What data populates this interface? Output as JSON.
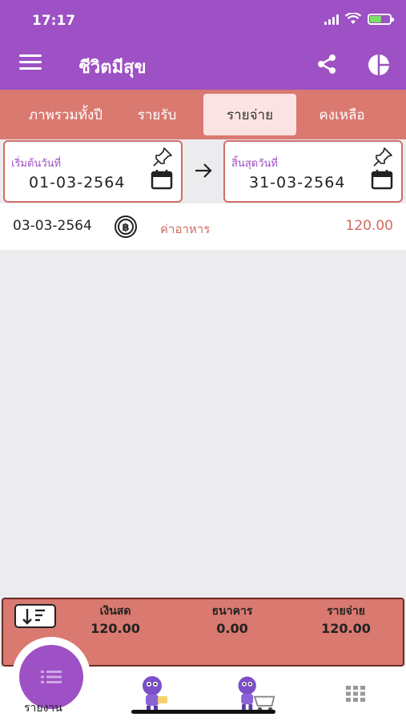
{
  "status": {
    "time": "17:17"
  },
  "header": {
    "title": "ชีวิตมีสุข"
  },
  "tabs": [
    {
      "label": "ภาพรวมทั้งปี",
      "active": false
    },
    {
      "label": "รายรับ",
      "active": false
    },
    {
      "label": "รายจ่าย",
      "active": true
    },
    {
      "label": "คงเหลือ",
      "active": false
    }
  ],
  "date_range": {
    "start": {
      "label": "เริ่มต้นวันที่",
      "value": "01-03-2564"
    },
    "end": {
      "label": "สิ้นสุดวันที่",
      "value": "31-03-2564"
    }
  },
  "transactions": [
    {
      "date": "03-03-2564",
      "icon": "baht-coin-icon",
      "category": "ค่าอาหาร",
      "amount": "120.00"
    }
  ],
  "summary": {
    "cash": {
      "label": "เงินสด",
      "value": "120.00"
    },
    "bank": {
      "label": "ธนาคาร",
      "value": "0.00"
    },
    "expense": {
      "label": "รายจ่าย",
      "value": "120.00"
    }
  },
  "bottom_nav": {
    "report_label": "รายงาน"
  },
  "colors": {
    "primary": "#9d51c4",
    "tab_bar": "#d9796f",
    "accent_text": "#d06a5f",
    "active_tab": "#fce3e3"
  }
}
